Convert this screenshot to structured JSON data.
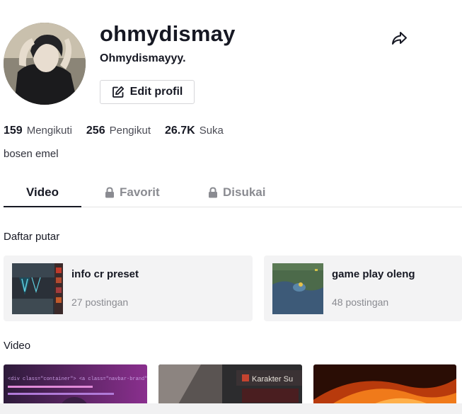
{
  "profile": {
    "username": "ohmydismay",
    "nickname": "Ohmydismayyy.",
    "edit_label": "Edit profil",
    "bio": "bosen emel"
  },
  "stats": [
    {
      "value": "159",
      "label": "Mengikuti"
    },
    {
      "value": "256",
      "label": "Pengikut"
    },
    {
      "value": "26.7K",
      "label": "Suka"
    }
  ],
  "tabs": [
    {
      "label": "Video",
      "active": true
    },
    {
      "label": "Favorit",
      "locked": true
    },
    {
      "label": "Disukai",
      "locked": true
    }
  ],
  "playlists_title": "Daftar putar",
  "playlists": [
    {
      "name": "info cr preset",
      "count": "27 postingan"
    },
    {
      "name": "game play oleng",
      "count": "48 postingan"
    }
  ],
  "videos_title": "Video",
  "video_thumbs": [
    {
      "text": "<div class=\"container\"> <a class=\"navbar-brand\" href=\"#\">Dismayyy</a> <button class=\"navbar\" type=\"button\" data"
    },
    {
      "text": "Karakter Su"
    },
    {
      "text": ""
    }
  ],
  "icons": {
    "share": "share-arrow-icon",
    "edit": "edit-pencil-icon",
    "lock": "lock-icon"
  }
}
